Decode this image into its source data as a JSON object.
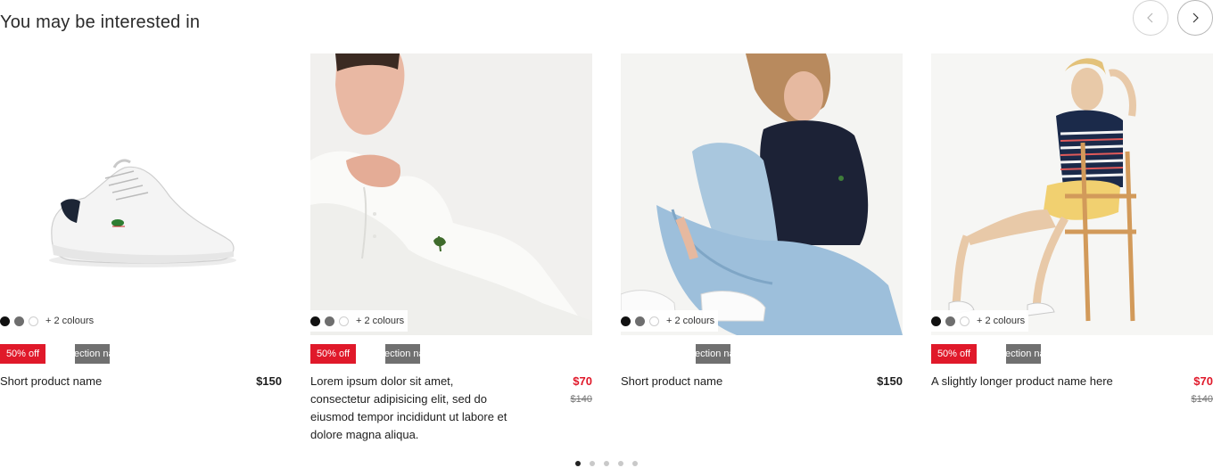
{
  "section": {
    "title": "You may be interested in"
  },
  "nav": {
    "prev_icon": "chevron-left-icon",
    "next_icon": "chevron-right-icon"
  },
  "products": [
    {
      "name": "Short product name",
      "price": "$150",
      "old_price": "",
      "discount": "50% off",
      "collection_badge": "Collection name",
      "more_colours": "+ 2 colours",
      "swatches": [
        "#111111",
        "#6e6e6e",
        "#ffffff"
      ],
      "image": "white-sneaker"
    },
    {
      "name": "Lorem ipsum dolor sit amet, consectetur adipisicing elit, sed do eiusmod tempor incididunt ut labore et dolore magna aliqua.",
      "price": "$70",
      "old_price": "$140",
      "discount": "50% off",
      "collection_badge": "Collection name",
      "more_colours": "+ 2 colours",
      "swatches": [
        "#111111",
        "#6e6e6e",
        "#ffffff"
      ],
      "image": "man-white-polo"
    },
    {
      "name": "Short product name",
      "price": "$150",
      "old_price": "",
      "discount": "",
      "collection_badge": "Collection name",
      "more_colours": "+ 2 colours",
      "swatches": [
        "#111111",
        "#6e6e6e",
        "#ffffff"
      ],
      "image": "woman-navy-polo-jeans"
    },
    {
      "name": "A slightly longer product name here",
      "price": "$70",
      "old_price": "$140",
      "discount": "50% off",
      "collection_badge": "Collection name",
      "more_colours": "+ 2 colours",
      "swatches": [
        "#111111",
        "#6e6e6e",
        "#ffffff"
      ],
      "image": "woman-striped-tee-chair"
    }
  ],
  "pagination": {
    "total": 5,
    "active": 1
  },
  "colors": {
    "sale": "#e0192a",
    "badge_grey": "#707070",
    "text": "#1e1e1e"
  }
}
